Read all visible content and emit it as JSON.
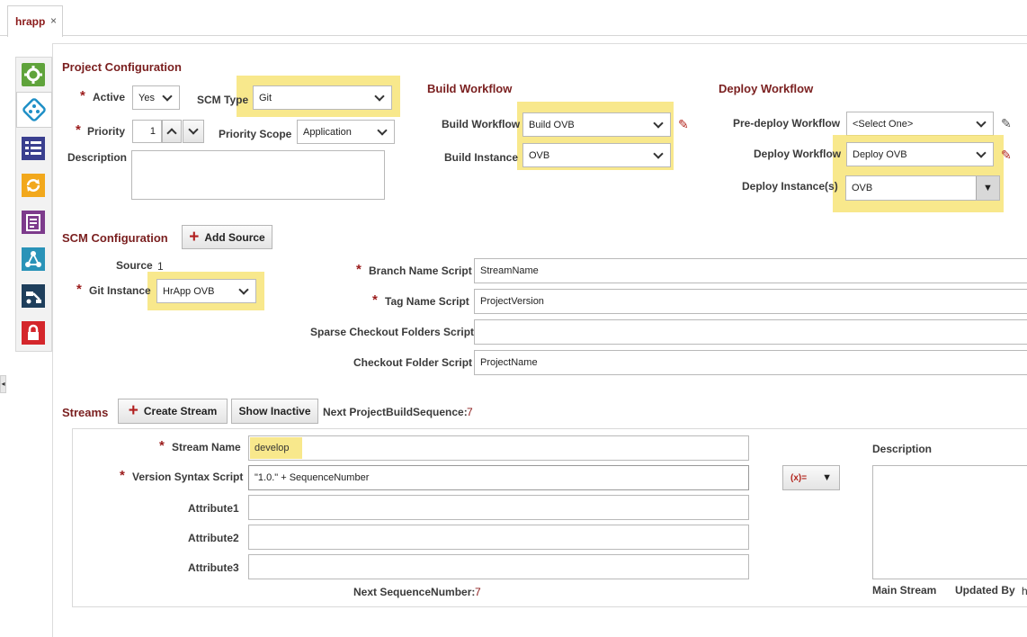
{
  "tab": {
    "label": "hrapp",
    "close": "×"
  },
  "icons": [
    "gear-icon",
    "deploy-diamond-icon",
    "list-icon",
    "refresh-icon",
    "report-icon",
    "network-icon",
    "robot-icon",
    "lock-icon"
  ],
  "colors": {
    "accent": "#7a1f1f",
    "highlight": "#f6e26b"
  },
  "project": {
    "title": "Project Configuration",
    "active_label": "Active",
    "active_value": "Yes",
    "scm_type_label": "SCM Type",
    "scm_type_value": "Git",
    "priority_label": "Priority",
    "priority_value": "1",
    "priority_scope_label": "Priority Scope",
    "priority_scope_value": "Application",
    "description_label": "Description"
  },
  "build": {
    "title": "Build Workflow",
    "workflow_label": "Build Workflow",
    "workflow_value": "Build OVB",
    "instance_label": "Build Instance",
    "instance_value": "OVB"
  },
  "deploy": {
    "title": "Deploy Workflow",
    "predeploy_label": "Pre-deploy Workflow",
    "predeploy_value": "<Select One>",
    "workflow_label": "Deploy Workflow",
    "workflow_value": "Deploy OVB",
    "instances_label": "Deploy Instance(s)",
    "instances_value": "OVB"
  },
  "scm": {
    "title": "SCM Configuration",
    "add_source": "Add Source",
    "source_label": "Source",
    "source_value": "1",
    "git_instance_label": "Git Instance",
    "git_instance_value": "HrApp OVB",
    "branch_label": "Branch Name Script",
    "branch_value": "StreamName",
    "tag_label": "Tag Name Script",
    "tag_value": "ProjectVersion",
    "sparse_label": "Sparse Checkout Folders Script",
    "sparse_value": "",
    "checkout_label": "Checkout Folder Script",
    "checkout_value": "ProjectName"
  },
  "streams": {
    "title": "Streams",
    "create": "Create Stream",
    "show_inactive": "Show Inactive",
    "next_seq_label": "Next ProjectBuildSequence:",
    "next_seq_value": "7",
    "stream_name_label": "Stream Name",
    "stream_name_value": "develop",
    "version_label": "Version Syntax Script",
    "version_value": "\"1.0.\" + SequenceNumber",
    "expr_button": "(x)=",
    "attr1_label": "Attribute1",
    "attr2_label": "Attribute2",
    "attr3_label": "Attribute3",
    "next_number_label": "Next SequenceNumber:",
    "next_number_value": "7",
    "description_label": "Description",
    "main_stream_label": "Main Stream",
    "updated_by_label": "Updated By",
    "updated_by_value": "h"
  }
}
